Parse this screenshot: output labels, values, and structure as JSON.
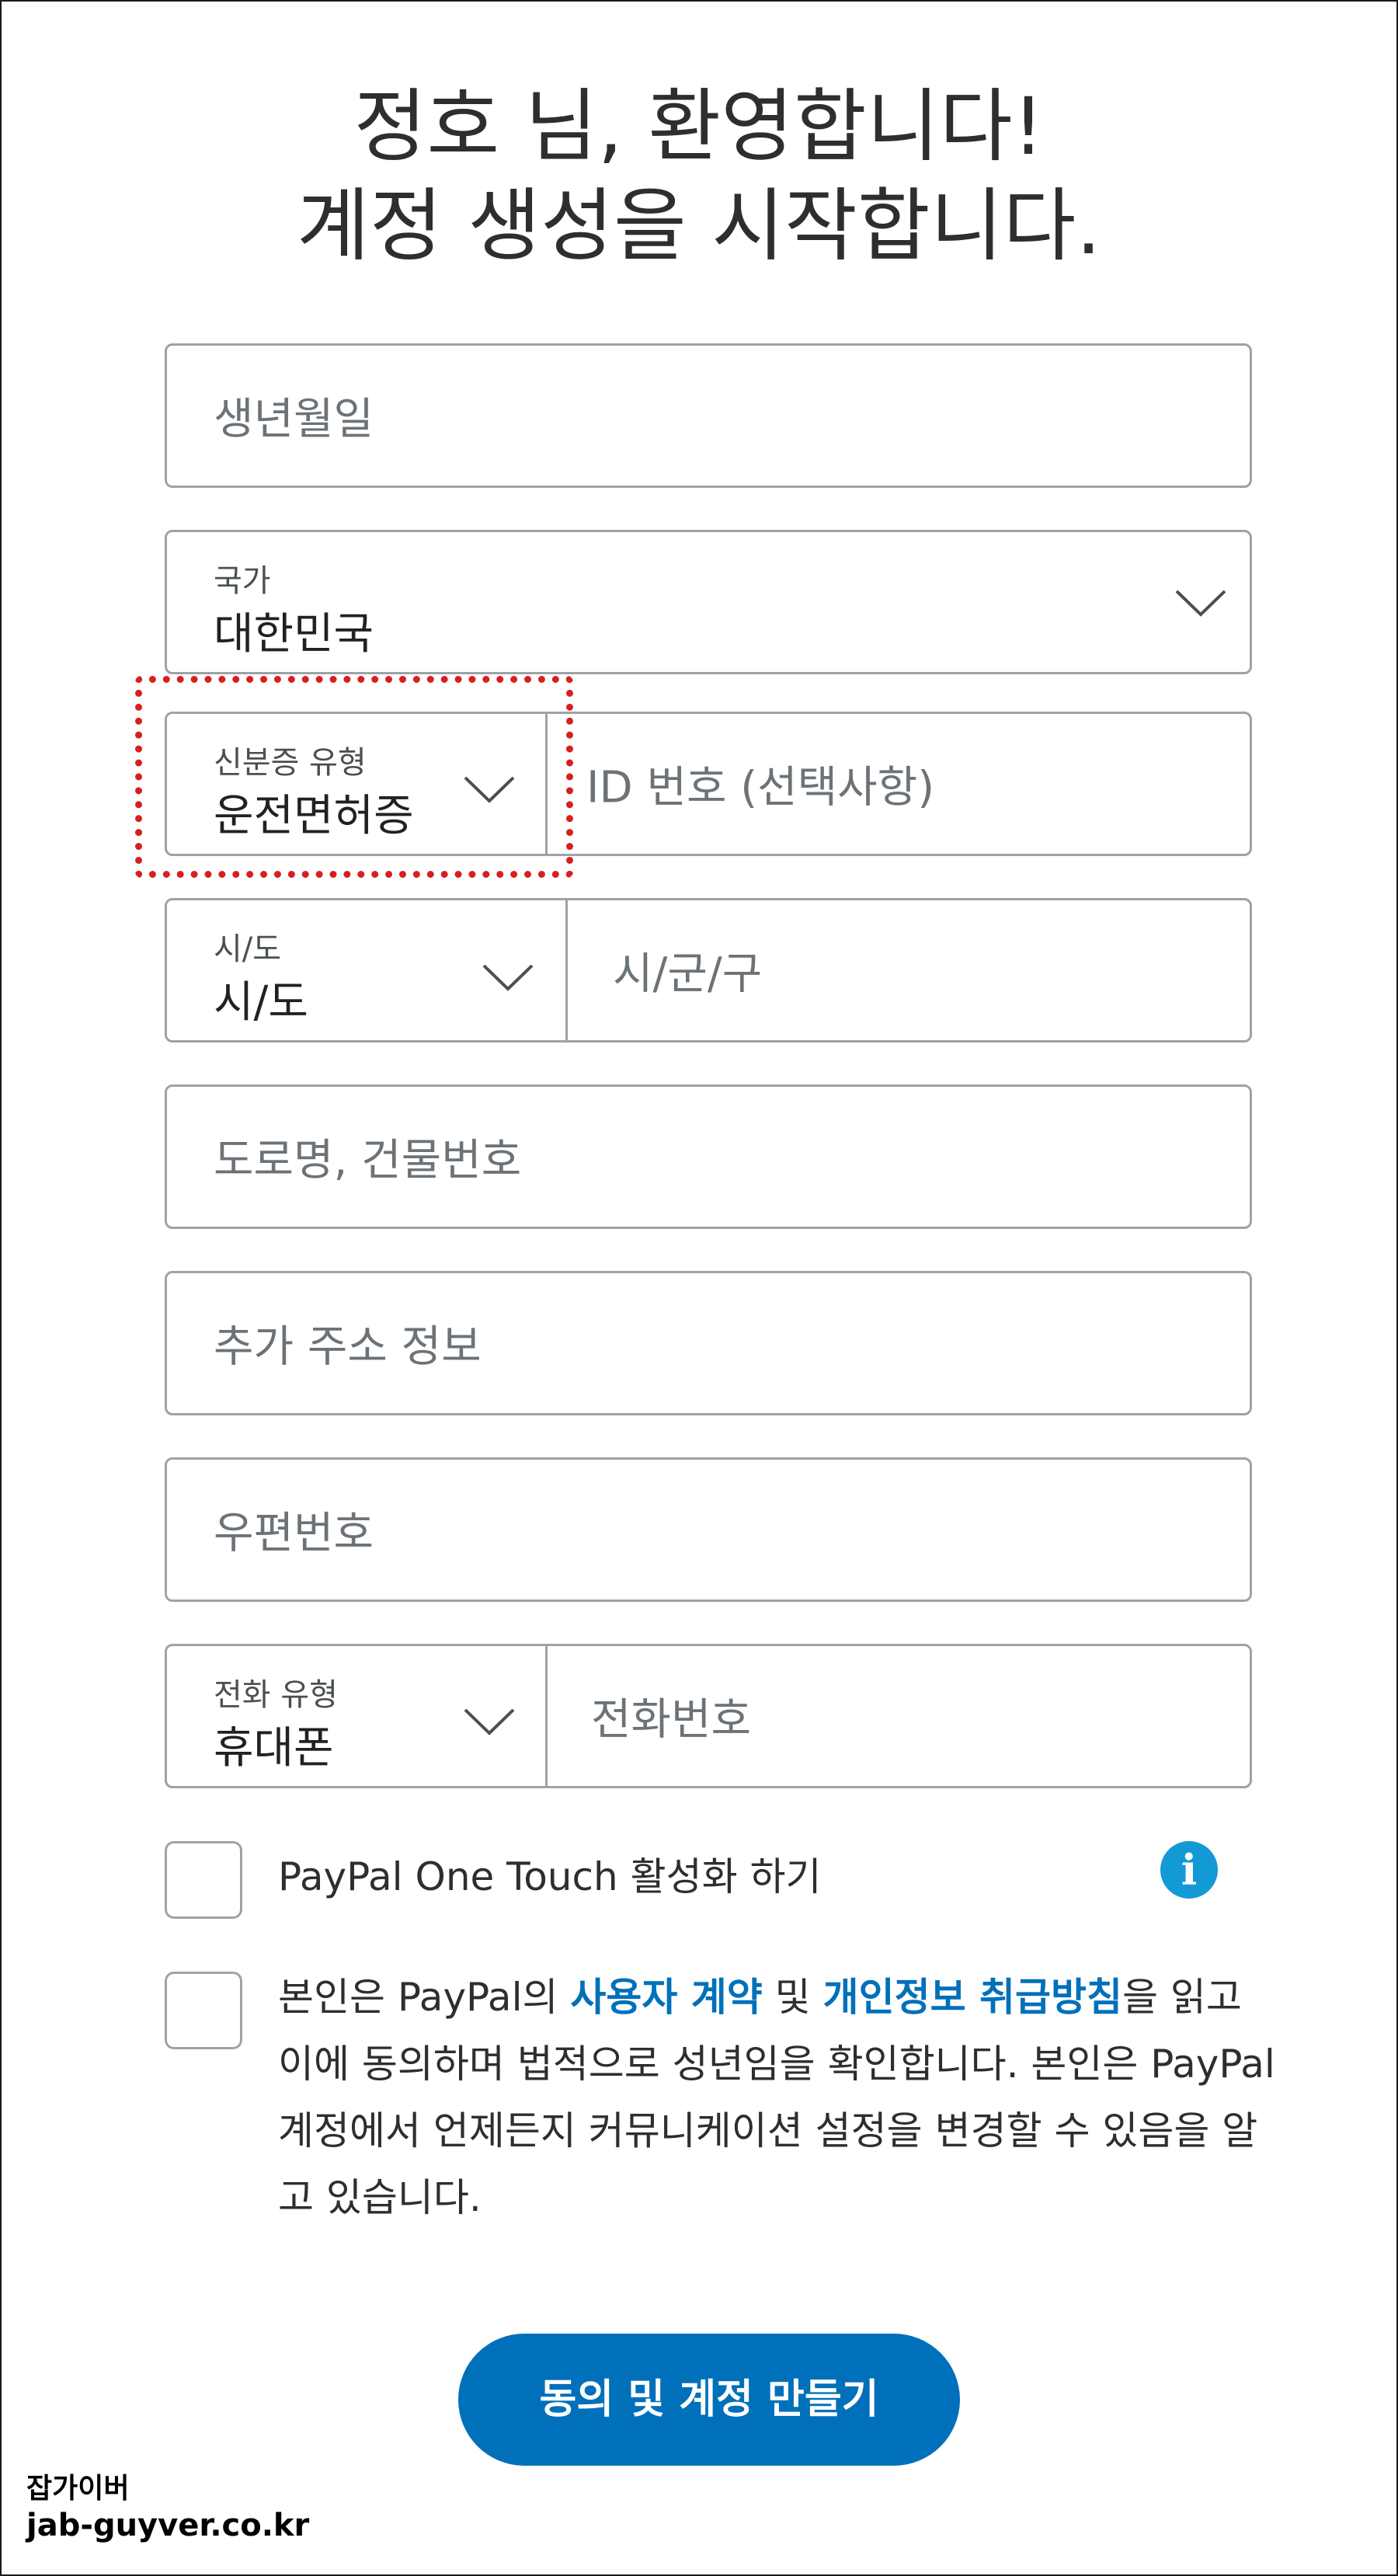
{
  "heading": {
    "line1": "정호 님, 환영합니다!",
    "line2": "계정 생성을 시작합니다."
  },
  "form": {
    "birthdate": {
      "placeholder": "생년월일"
    },
    "country": {
      "label": "국가",
      "value": "대한민국"
    },
    "id_type": {
      "label": "신분증 유형",
      "value": "운전면허증"
    },
    "id_number": {
      "placeholder": "ID 번호 (선택사항)"
    },
    "province": {
      "label": "시/도",
      "value": "시/도"
    },
    "city": {
      "placeholder": "시/군/구"
    },
    "street": {
      "placeholder": "도로명, 건물번호"
    },
    "address_extra": {
      "placeholder": "추가 주소 정보"
    },
    "postal_code": {
      "placeholder": "우편번호"
    },
    "phone_type": {
      "label": "전화 유형",
      "value": "휴대폰"
    },
    "phone_number": {
      "placeholder": "전화번호"
    }
  },
  "one_touch": {
    "label": "PayPal One Touch 활성화 하기",
    "info_icon": "info-icon",
    "info_glyph": "i"
  },
  "consent": {
    "text_1": "본인은 PayPal의 ",
    "link_user_agreement": "사용자 계약",
    "text_2": " 및 ",
    "link_privacy": "개인정보 취급방침",
    "text_3": "을 읽고 이에 동의하며 법적으로 성년임을 확인합니다. 본인은 PayPal 계정에서 언제든지 커뮤니케이션 설정을 변경할 수 있음을 알고 있습니다."
  },
  "submit_label": "동의 및 계정 만들기",
  "watermark": {
    "line1": "잡가이버",
    "line2": "jab-guyver.co.kr"
  },
  "colors": {
    "primary": "#0070ba",
    "info_icon": "#139ad6",
    "highlight": "#d62020",
    "border": "#9da3a6"
  }
}
